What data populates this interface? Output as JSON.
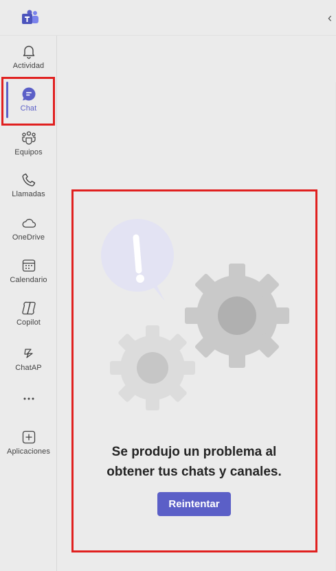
{
  "app": {
    "logo_icon": "teams-logo-icon",
    "collapse_icon": "chevron-left-icon"
  },
  "rail": {
    "items": [
      {
        "label": "Actividad",
        "icon": "bell-icon"
      },
      {
        "label": "Chat",
        "icon": "chat-icon",
        "active": true
      },
      {
        "label": "Equipos",
        "icon": "teams-people-icon"
      },
      {
        "label": "Llamadas",
        "icon": "phone-icon"
      },
      {
        "label": "OneDrive",
        "icon": "cloud-icon"
      },
      {
        "label": "Calendario",
        "icon": "calendar-icon"
      },
      {
        "label": "Copilot",
        "icon": "copilot-icon"
      },
      {
        "label": "ChatAP",
        "icon": "chatap-icon"
      },
      {
        "label": "",
        "icon": "more-icon"
      },
      {
        "label": "Aplicaciones",
        "icon": "add-apps-icon"
      }
    ]
  },
  "error": {
    "message_line1": "Se produjo un problema al",
    "message_line2": "obtener tus chats y canales.",
    "retry_label": "Reintentar"
  },
  "colors": {
    "accent": "#5b5fc7",
    "highlight": "#e0201f",
    "background": "#ebebeb"
  }
}
